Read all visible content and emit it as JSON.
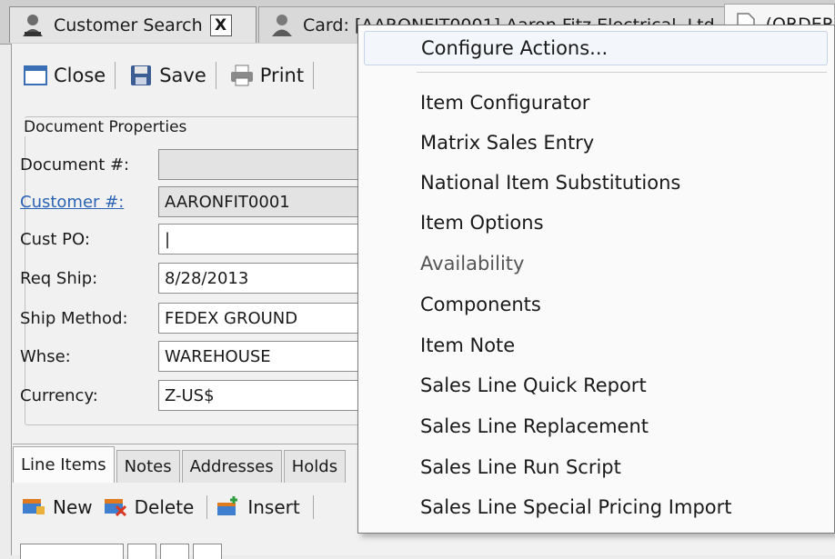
{
  "tabs": [
    {
      "label": "Customer Search",
      "icon": "person-search-icon",
      "close": "X"
    },
    {
      "label": "Card: [AARONFIT0001] Aaron Fitz Electrical, Ltd.",
      "icon": "person-card-icon"
    },
    {
      "label": "(ORDER",
      "icon": "document-icon"
    }
  ],
  "toolbar": {
    "close_label": "Close",
    "save_label": "Save",
    "print_label": "Print"
  },
  "document_properties": {
    "title": "Document Properties",
    "fields": [
      {
        "label": "Document #:",
        "value": "",
        "readonly": true
      },
      {
        "label": "Customer #:",
        "value": "AARONFIT0001",
        "readonly": true,
        "link": true
      },
      {
        "label": "Cust PO:",
        "value": "|",
        "readonly": false
      },
      {
        "label": "Req Ship:",
        "value": "8/28/2013",
        "readonly": false
      },
      {
        "label": "Ship Method:",
        "value": "FEDEX GROUND",
        "readonly": false
      },
      {
        "label": "Whse:",
        "value": "WAREHOUSE",
        "readonly": false
      },
      {
        "label": "Currency:",
        "value": "Z-US$",
        "readonly": false
      }
    ]
  },
  "subtabs": [
    "Line Items",
    "Notes",
    "Addresses",
    "Holds"
  ],
  "line_toolbar": {
    "new_label": "New",
    "delete_label": "Delete",
    "insert_label": "Insert"
  },
  "menu": {
    "items": [
      "Configure Actions...",
      "Item Configurator",
      "Matrix Sales Entry",
      "National Item Substitutions",
      "Item Options",
      "Availability",
      "Components",
      "Item Note",
      "Sales Line Quick Report",
      "Sales Line Replacement",
      "Sales Line Run Script",
      "Sales Line Special Pricing Import"
    ]
  },
  "colors": {
    "link": "#2a64b4",
    "menu_highlight": "#f3f6fb"
  }
}
